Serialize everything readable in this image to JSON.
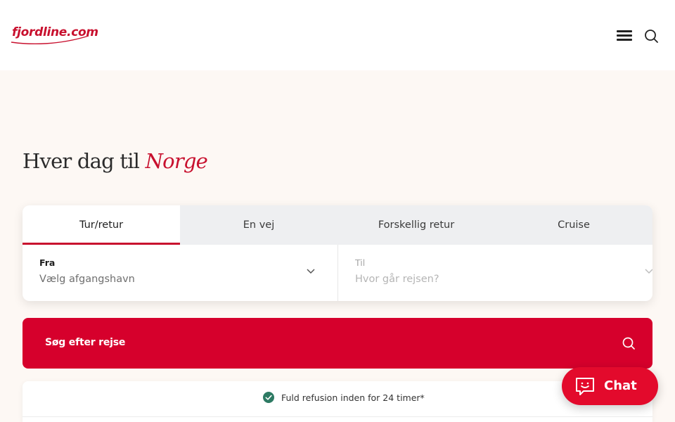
{
  "header": {
    "logo_text": "fjordline.com",
    "menu_icon": "hamburger-menu-icon",
    "search_icon": "search-icon"
  },
  "hero": {
    "headline_prefix": "Hver dag til",
    "headline_accent": "Norge"
  },
  "booking": {
    "tabs": [
      {
        "label": "Tur/retur",
        "active": true
      },
      {
        "label": "En vej",
        "active": false
      },
      {
        "label": "Forskellig retur",
        "active": false
      },
      {
        "label": "Cruise",
        "active": false
      }
    ],
    "from": {
      "label": "Fra",
      "placeholder": "Vælg afgangshavn"
    },
    "to": {
      "label": "Til",
      "placeholder": "Hvor går rejsen?"
    }
  },
  "search_button": {
    "label": "Søg efter rejse"
  },
  "refund": {
    "text": "Fuld refusion inden for 24 timer*"
  },
  "chat": {
    "label": "Chat"
  },
  "colors": {
    "brand_red": "#c8102e",
    "button_red": "#d6002c",
    "chat_red": "#e30a2c",
    "check_green": "#2d7a63",
    "background": "#fdf8f4"
  }
}
